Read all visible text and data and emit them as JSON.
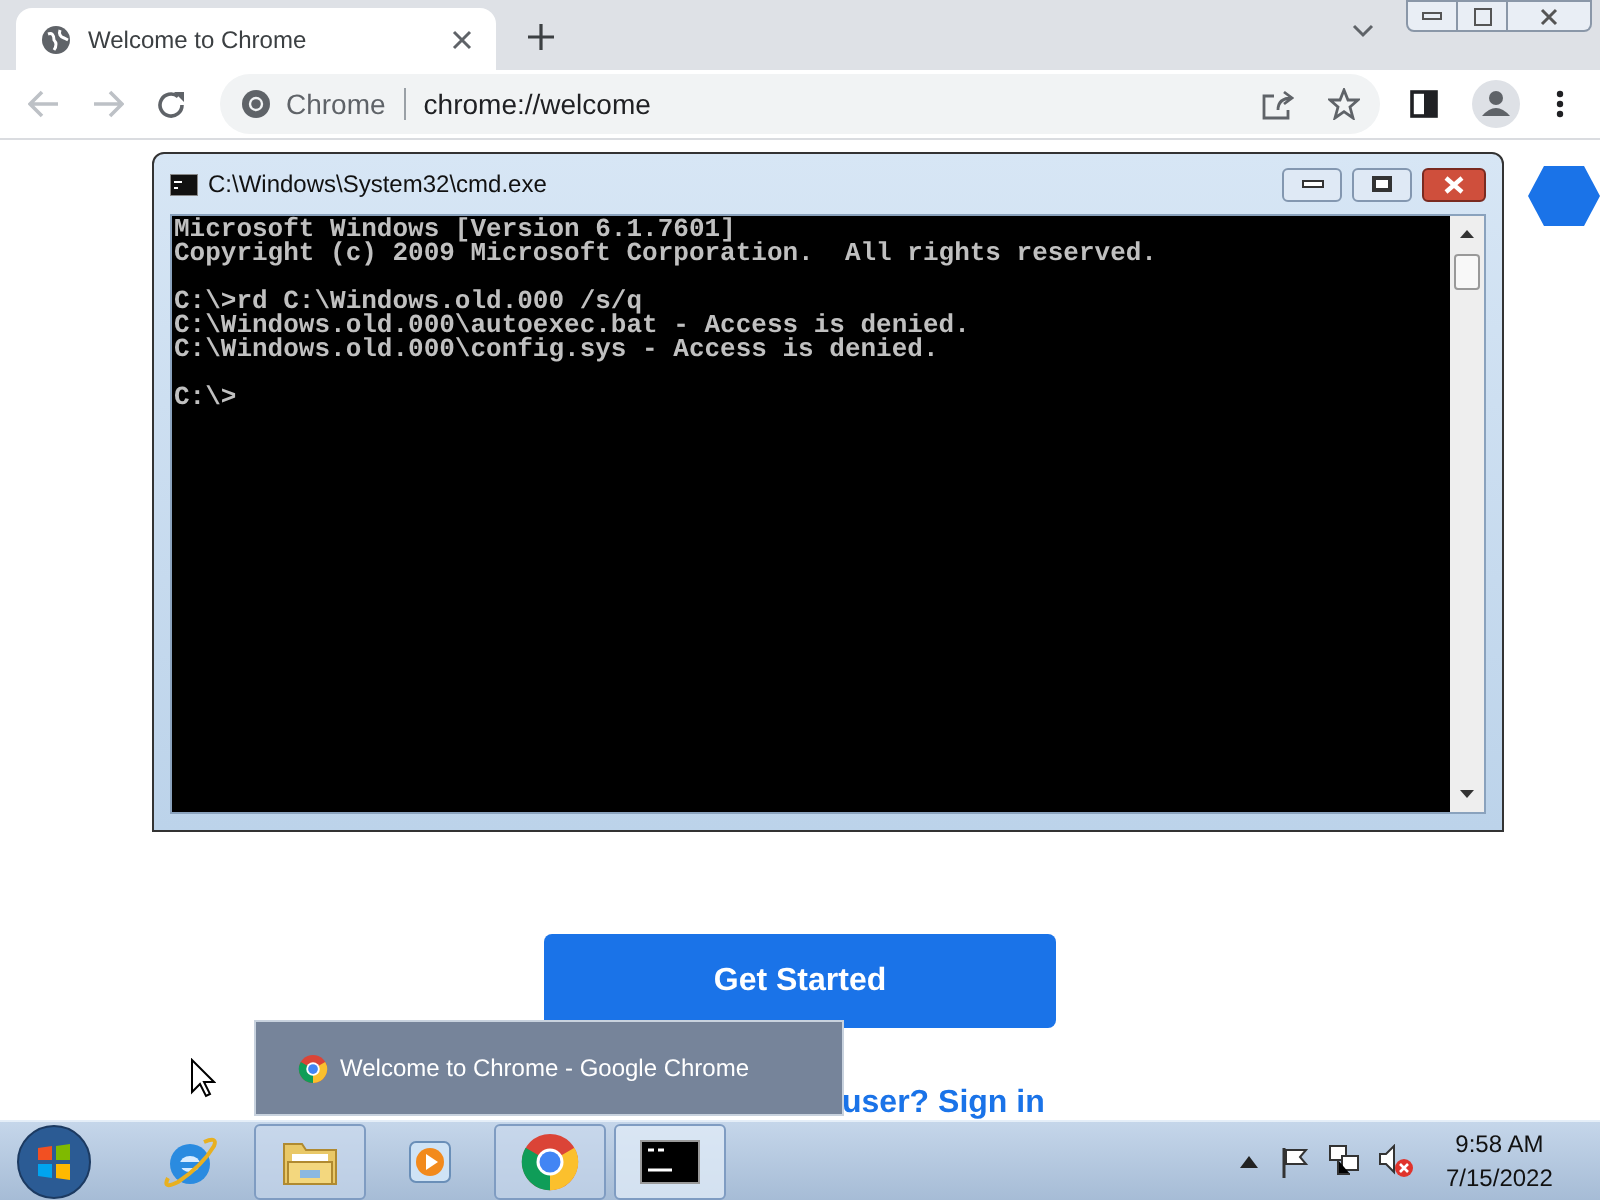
{
  "browser": {
    "tab": {
      "title": "Welcome to Chrome",
      "selected": true
    },
    "omnibox": {
      "site_label": "Chrome",
      "url": "chrome://welcome"
    }
  },
  "page": {
    "primary_button": "Get Started",
    "sign_in_link": "user? Sign in"
  },
  "console_window": {
    "title": "C:\\Windows\\System32\\cmd.exe",
    "blocks": [
      [
        "Microsoft Windows [Version 6.1.7601]",
        "Copyright (c) 2009 Microsoft Corporation.  All rights reserved."
      ],
      [
        "C:\\>rd C:\\Windows.old.000 /s/q",
        "C:\\Windows.old.000\\autoexec.bat - Access is denied.",
        "C:\\Windows.old.000\\config.sys - Access is denied."
      ],
      [
        "C:\\>"
      ]
    ]
  },
  "taskbar_preview": {
    "title": "Welcome to Chrome - Google Chrome"
  },
  "taskbar": {
    "items": [
      {
        "kind": "ie",
        "running": false,
        "selected": false
      },
      {
        "kind": "folder",
        "running": true,
        "selected": false
      },
      {
        "kind": "media",
        "running": false,
        "selected": false
      },
      {
        "kind": "chrome",
        "running": true,
        "selected": false
      },
      {
        "kind": "console",
        "running": true,
        "selected": true
      }
    ],
    "clock": {
      "time": "9:58 AM",
      "date": "7/15/2022"
    }
  }
}
